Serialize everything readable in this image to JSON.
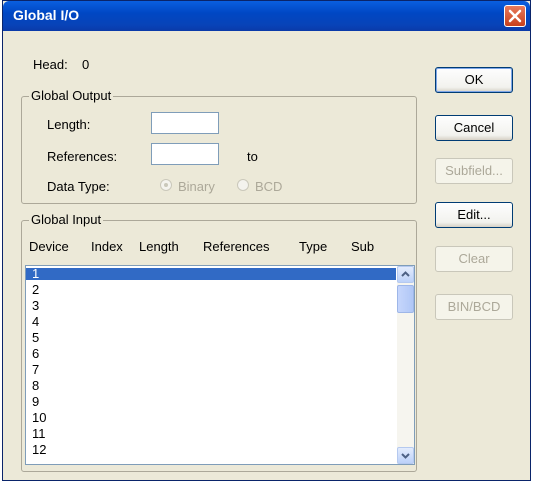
{
  "window": {
    "title": "Global I/O"
  },
  "head": {
    "label": "Head:",
    "value": "0"
  },
  "global_output": {
    "group_label": "Global Output",
    "length_label": "Length:",
    "references_label": "References:",
    "to_label": "to",
    "data_type_label": "Data Type:",
    "radio_binary": "Binary",
    "radio_bcd": "BCD"
  },
  "global_input": {
    "group_label": "Global Input",
    "columns": [
      "Device",
      "Index",
      "Length",
      "References",
      "Type",
      "Sub"
    ],
    "rows": [
      "1",
      "2",
      "3",
      "4",
      "5",
      "6",
      "7",
      "8",
      "9",
      "10",
      "11",
      "12"
    ],
    "selected_row": "1"
  },
  "buttons": {
    "ok": "OK",
    "cancel": "Cancel",
    "subfield": "Subfield...",
    "edit": "Edit...",
    "clear": "Clear",
    "bin_bcd": "BIN/BCD"
  },
  "colors": {
    "title_bar": "#0a50d8",
    "selection": "#316ac5",
    "dialog_bg": "#ece9d8"
  }
}
